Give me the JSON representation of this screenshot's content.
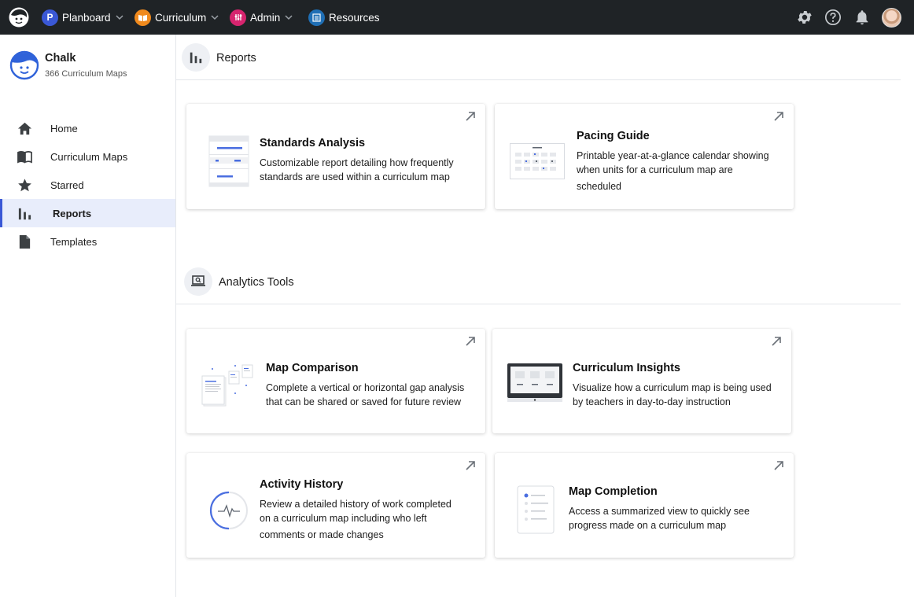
{
  "topbar": {
    "nav": [
      {
        "label": "Planboard",
        "badge": "P",
        "badge_color": "#3a58d6",
        "has_menu": true
      },
      {
        "label": "Curriculum",
        "badge": "📖",
        "badge_color": "#f08a1d",
        "has_menu": true
      },
      {
        "label": "Admin",
        "badge": "⚙",
        "badge_color": "#d6246e",
        "has_menu": true
      },
      {
        "label": "Resources",
        "badge": "≣",
        "badge_color": "#1f6fb5",
        "has_menu": false
      }
    ],
    "icons": [
      "gear-icon",
      "help-icon",
      "bell-icon",
      "avatar"
    ]
  },
  "sidebar": {
    "org_name": "Chalk",
    "org_sub": "366 Curriculum Maps",
    "items": [
      {
        "label": "Home",
        "icon": "home-icon"
      },
      {
        "label": "Curriculum Maps",
        "icon": "book-icon"
      },
      {
        "label": "Starred",
        "icon": "star-icon"
      },
      {
        "label": "Reports",
        "icon": "bar-chart-icon",
        "active": true
      },
      {
        "label": "Templates",
        "icon": "document-icon"
      }
    ]
  },
  "sections": {
    "reports": {
      "title": "Reports"
    },
    "analytics": {
      "title": "Analytics Tools"
    }
  },
  "cards": {
    "standards": {
      "title": "Standards Analysis",
      "desc1": "Customizable report detailing how frequently",
      "desc2": "standards are used within a curriculum map"
    },
    "pacing": {
      "title": "Pacing Guide",
      "desc1": "Printable year-at-a-glance calendar showing",
      "desc2": "when units for a curriculum map are",
      "desc3": "scheduled"
    },
    "comparison": {
      "title": "Map Comparison",
      "desc1": "Complete a vertical or horizontal gap analysis",
      "desc2": "that can be shared or saved for future review"
    },
    "insights": {
      "title": "Curriculum Insights",
      "desc1": "Visualize how a curriculum map is being used",
      "desc2": "by teachers in day-to-day instruction"
    },
    "activity": {
      "title": "Activity History",
      "desc1": "Review a detailed history of work completed",
      "desc2": "on a curriculum map including who left",
      "desc3": "comments or made changes"
    },
    "completion": {
      "title": "Map Completion",
      "desc1": "Access a summarized view to quickly see",
      "desc2": "progress made on a curriculum map"
    }
  },
  "colors": {
    "accent": "#3a58d6",
    "topbar": "#1f2326",
    "active_bg": "#e8edfb"
  }
}
